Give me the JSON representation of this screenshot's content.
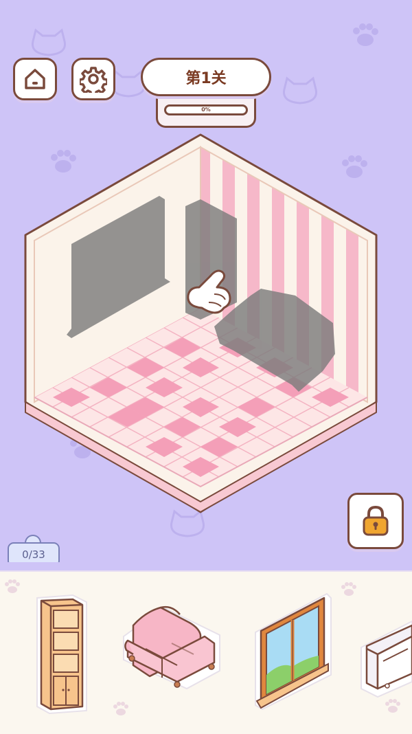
{
  "header": {
    "home_icon": "home-icon",
    "settings_icon": "gear-icon",
    "level_title": "第1关",
    "progress_label": "0%",
    "progress_value": 0
  },
  "room": {
    "floor_color": "#f6b8c9",
    "wall_color": "#fbf3ea",
    "stripe_color": "#f6b8c9"
  },
  "side": {
    "lock_icon": "lock-icon"
  },
  "inventory": {
    "placed_count": "0/33",
    "items": [
      {
        "icon": "bookshelf-icon"
      },
      {
        "icon": "sofa-icon"
      },
      {
        "icon": "window-icon"
      },
      {
        "icon": "cabinet-icon"
      }
    ]
  },
  "colors": {
    "background": "#cec4f7",
    "accent_brown": "#7a4a3c",
    "lock_gold": "#f0a530"
  }
}
